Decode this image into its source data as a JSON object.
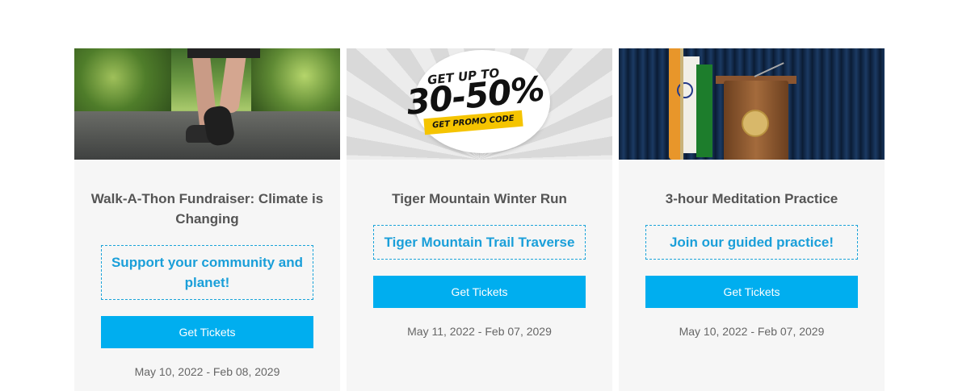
{
  "events": [
    {
      "title": "Walk-A-Thon Fundraiser: Climate is Changing",
      "subtitle": "Support your community and planet!",
      "button_label": "Get Tickets",
      "dates": "May 10, 2022 - Feb 08, 2029",
      "image": "walking-feet-image"
    },
    {
      "title": "Tiger Mountain Winter Run",
      "subtitle": "Tiger Mountain Trail Traverse",
      "button_label": "Get Tickets",
      "dates": "May 11, 2022 - Feb 07, 2029",
      "image": "promo-banner-image",
      "promo": {
        "line1": "GET UP TO",
        "line2": "30-50%",
        "line3": "GET PROMO CODE"
      }
    },
    {
      "title": "3-hour Meditation Practice",
      "subtitle": "Join our guided practice!",
      "button_label": "Get Tickets",
      "dates": "May 10, 2022 - Feb 07, 2029",
      "image": "flag-podium-image"
    }
  ],
  "colors": {
    "button": "#00aeef",
    "subtitle_text": "#1a9fd9",
    "card_bg": "#f6f6f6"
  }
}
